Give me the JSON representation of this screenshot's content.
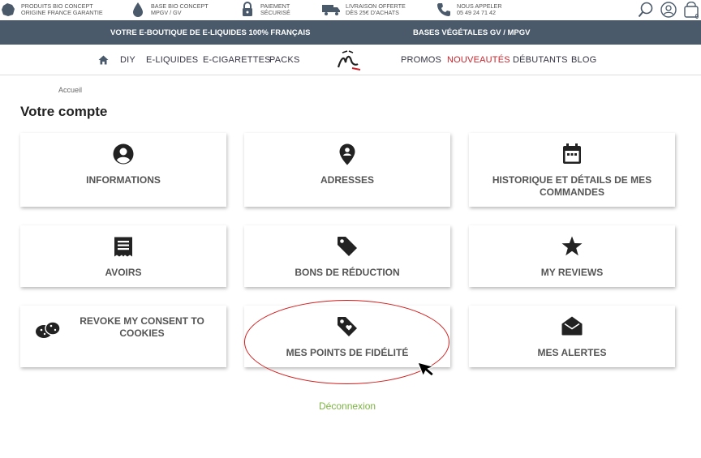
{
  "infobar": {
    "items": [
      {
        "line1": "PRODUITS BIO CONCEPT",
        "line2": "ORIGINE FRANCE GARANTIE",
        "icon": "france-map-icon"
      },
      {
        "line1": "BASE BIO CONCEPT",
        "line2": "MPGV / GV",
        "icon": "drop-icon"
      },
      {
        "line1": "PAIEMENT",
        "line2": "SÉCURISÉ",
        "icon": "lock-icon"
      },
      {
        "line1": "LIVRAISON OFFERTE",
        "line2": "DÈS 25€ D'ACHATS",
        "icon": "truck-icon"
      },
      {
        "line1": "NOUS APPELER",
        "line2": "05 49 24 71 42",
        "icon": "phone-icon"
      }
    ],
    "cart_count": "0"
  },
  "darkbar": {
    "left": "VOTRE E-BOUTIQUE DE E-LIQUIDES 100% FRANÇAIS",
    "right": "BASES VÉGÉTALES GV / MPGV"
  },
  "nav": {
    "left": [
      "DIY",
      "E-LIQUIDES",
      "E-CIGARETTES",
      "PACKS"
    ],
    "right": [
      "PROMOS",
      "NOUVEAUTÉS",
      "DÉBUTANTS",
      "BLOG"
    ]
  },
  "breadcrumb": "Accueil",
  "page_title": "Votre compte",
  "cards": [
    {
      "label": "INFORMATIONS",
      "icon": "user-circle-icon"
    },
    {
      "label": "ADRESSES",
      "icon": "map-pin-icon"
    },
    {
      "label": "HISTORIQUE ET DÉTAILS DE MES COMMANDES",
      "icon": "calendar-icon"
    },
    {
      "label": "AVOIRS",
      "icon": "receipt-icon"
    },
    {
      "label": "BONS DE RÉDUCTION",
      "icon": "tag-icon"
    },
    {
      "label": "MY REVIEWS",
      "icon": "star-icon"
    },
    {
      "label": "REVOKE MY CONSENT TO COOKIES",
      "icon": "cookie-icon"
    },
    {
      "label": "MES POINTS DE FIDÉLITÉ",
      "icon": "tag-heart-icon"
    },
    {
      "label": "MES ALERTES",
      "icon": "envelope-open-icon"
    }
  ],
  "logout": "Déconnexion",
  "colors": {
    "dark_bar": "#4a5a6b",
    "accent_red": "#c8242b",
    "logout_green": "#7cb342"
  }
}
